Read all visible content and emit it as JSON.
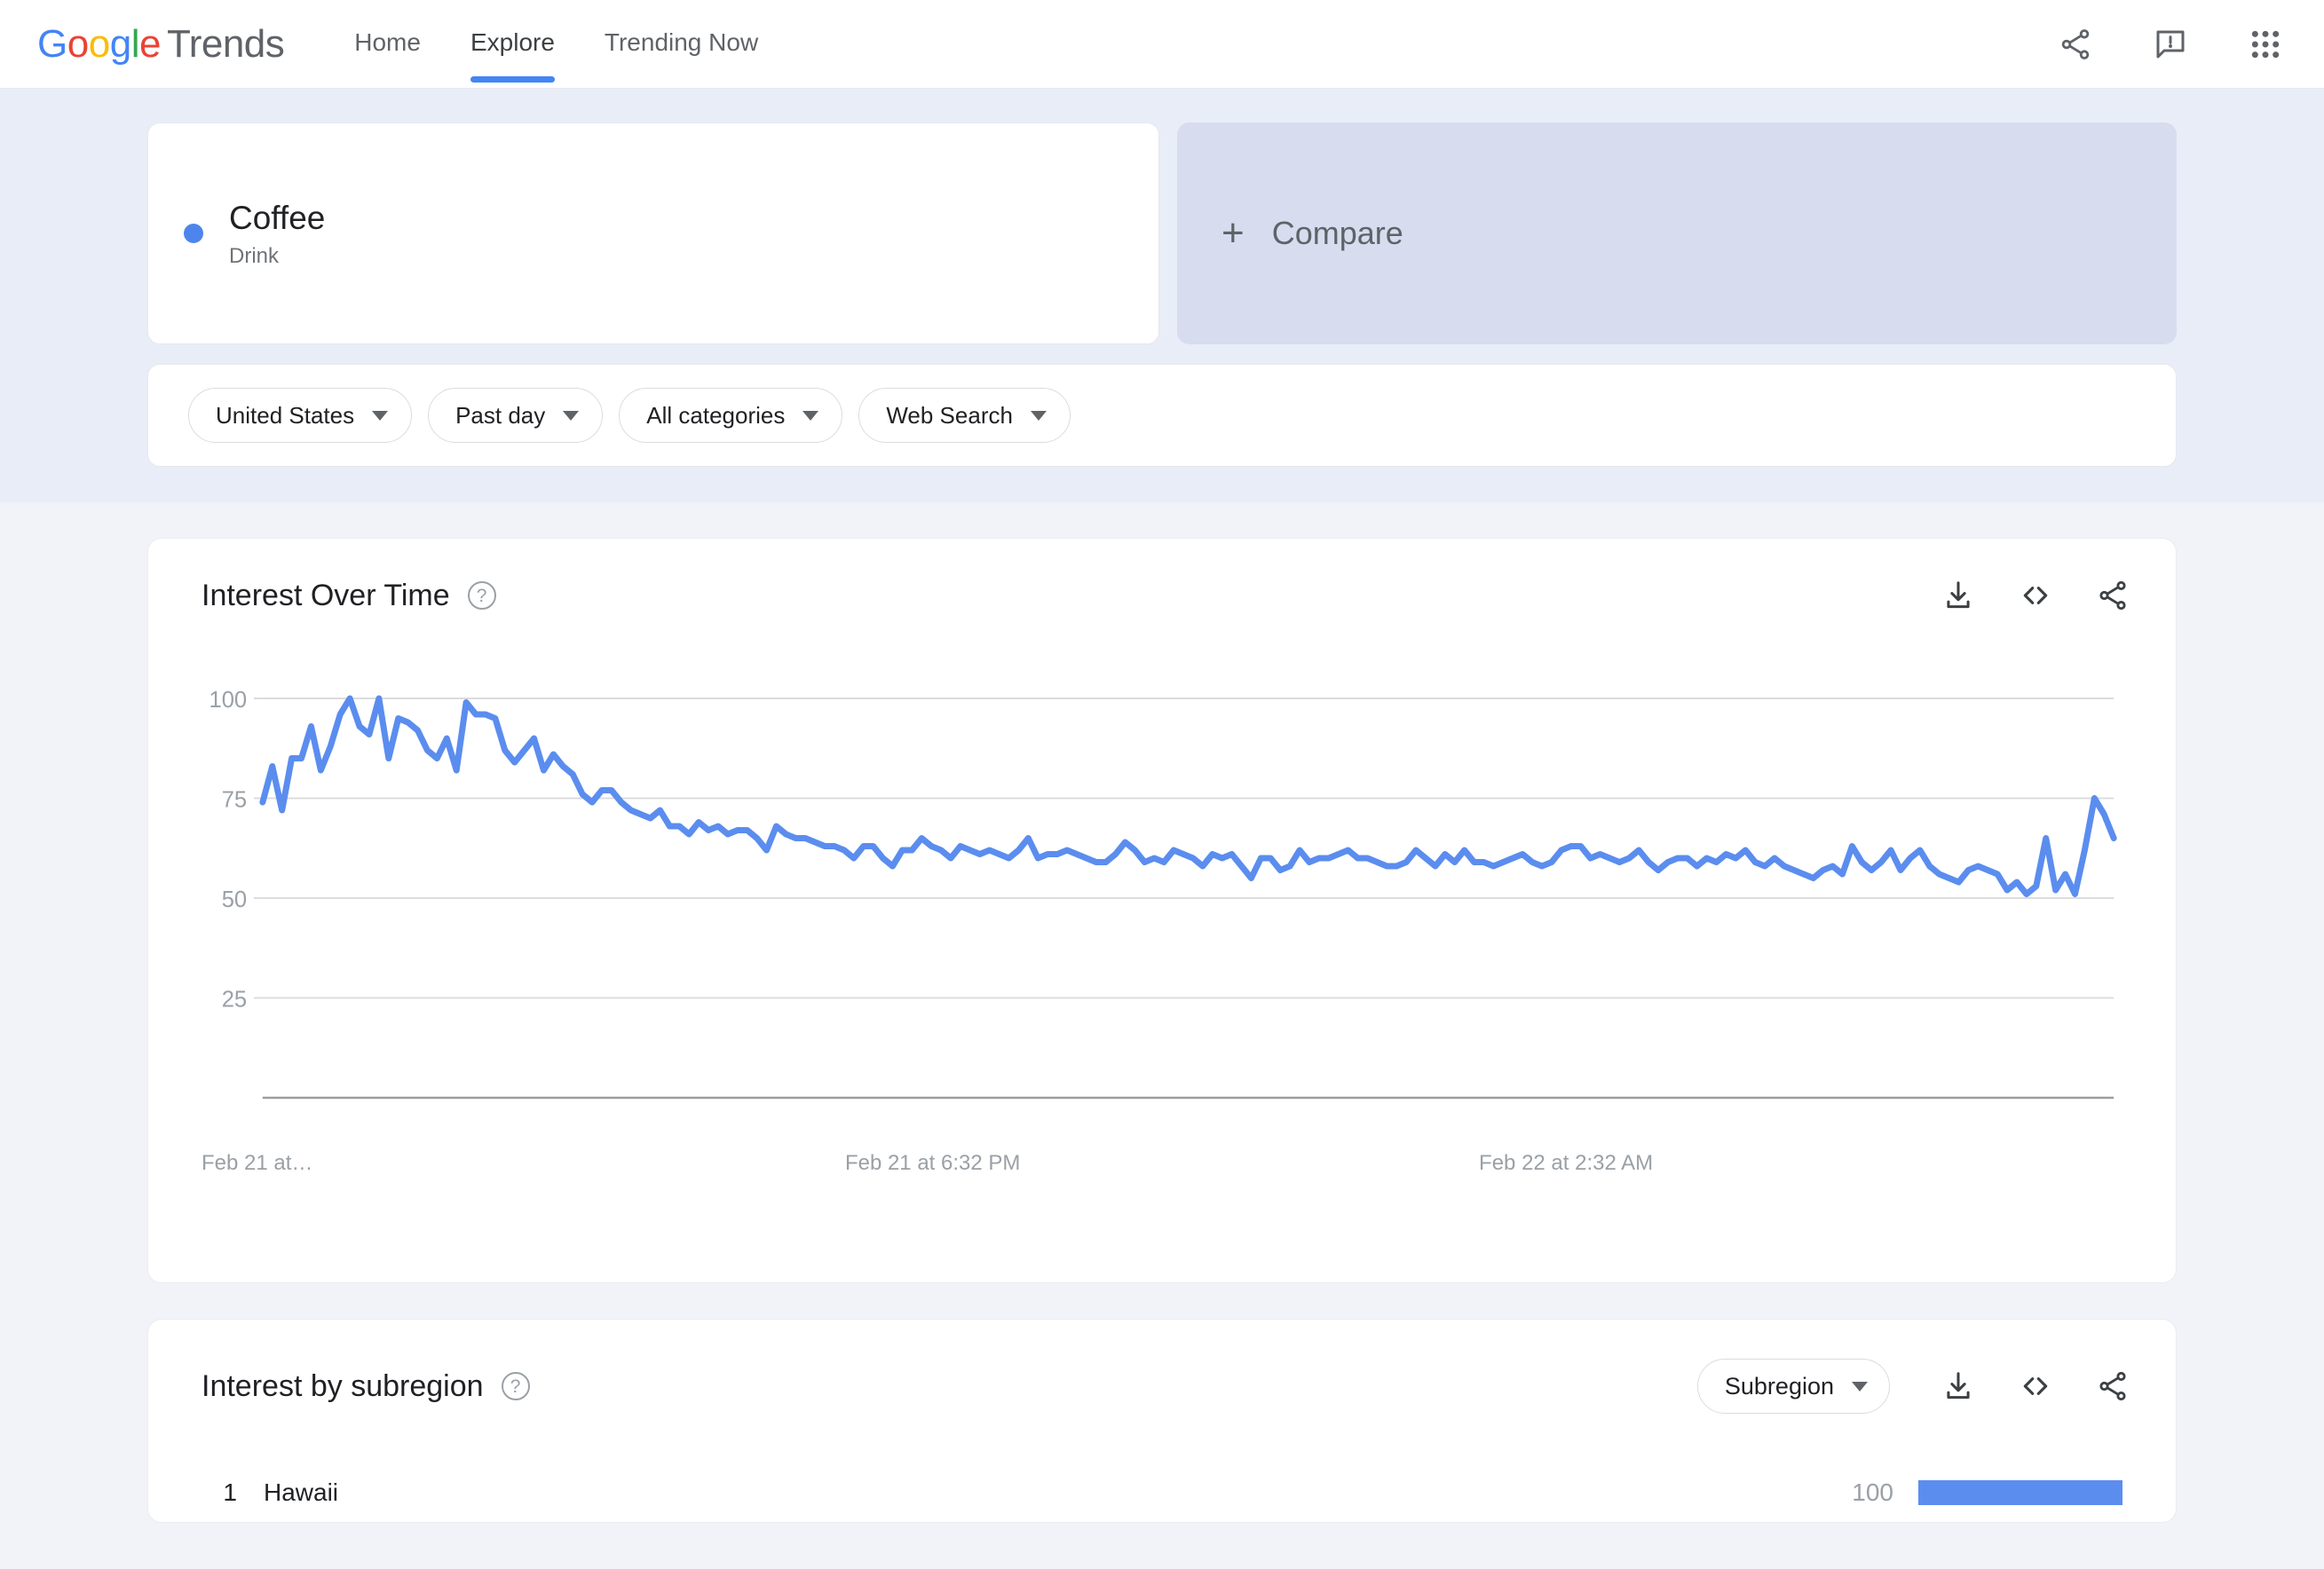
{
  "header": {
    "logo": {
      "google": "Google",
      "trends": "Trends"
    },
    "nav": [
      {
        "label": "Home",
        "active": false
      },
      {
        "label": "Explore",
        "active": true
      },
      {
        "label": "Trending Now",
        "active": false
      }
    ],
    "actions": [
      {
        "name": "share-icon",
        "label": "Share"
      },
      {
        "name": "feedback-icon",
        "label": "Send feedback"
      },
      {
        "name": "apps-grid-icon",
        "label": "Google apps"
      }
    ]
  },
  "query": {
    "term": {
      "title": "Coffee",
      "subtitle": "Drink",
      "color": "#4e85ec"
    },
    "compare": {
      "label": "Compare",
      "plus": "+"
    },
    "filters": [
      {
        "name": "location-filter",
        "label": "United States"
      },
      {
        "name": "time-filter",
        "label": "Past day"
      },
      {
        "name": "category-filter",
        "label": "All categories"
      },
      {
        "name": "search-type-filter",
        "label": "Web Search"
      }
    ]
  },
  "interest_over_time": {
    "title": "Interest Over Time",
    "help": "?",
    "actions": [
      {
        "name": "download-icon",
        "label": "Download CSV"
      },
      {
        "name": "embed-code-icon",
        "label": "Embed"
      },
      {
        "name": "share-icon",
        "label": "Share"
      }
    ]
  },
  "interest_by_subregion": {
    "title": "Interest by subregion",
    "help": "?",
    "dropdown_label": "Subregion",
    "actions": [
      {
        "name": "download-icon",
        "label": "Download CSV"
      },
      {
        "name": "embed-code-icon",
        "label": "Embed"
      },
      {
        "name": "share-icon",
        "label": "Share"
      }
    ],
    "rows": [
      {
        "rank": "1",
        "name": "Hawaii",
        "value": "100",
        "bar_pct": 100
      }
    ]
  },
  "chart_data": {
    "type": "line",
    "title": "Interest Over Time",
    "xlabel": "",
    "ylabel": "",
    "ylim": [
      0,
      108
    ],
    "yticks": [
      25,
      50,
      75,
      100
    ],
    "ytick_labels": [
      "25",
      "50",
      "75",
      "100"
    ],
    "grid": true,
    "legend": false,
    "line_color": "#5b8def",
    "x_tick_labels": [
      "Feb 21 at…",
      "Feb 21 at 6:32 PM",
      "Feb 22 at 2:32 AM"
    ],
    "x_tick_positions": [
      0.0,
      0.335,
      0.665
    ],
    "series": [
      {
        "name": "Coffee",
        "values": [
          74,
          83,
          72,
          85,
          85,
          93,
          82,
          88,
          96,
          100,
          93,
          91,
          100,
          85,
          95,
          94,
          92,
          87,
          85,
          90,
          82,
          99,
          96,
          96,
          95,
          87,
          84,
          87,
          90,
          82,
          86,
          83,
          81,
          76,
          74,
          77,
          77,
          74,
          72,
          71,
          70,
          72,
          68,
          68,
          66,
          69,
          67,
          68,
          66,
          67,
          67,
          65,
          62,
          68,
          66,
          65,
          65,
          64,
          63,
          63,
          62,
          60,
          63,
          63,
          60,
          58,
          62,
          62,
          65,
          63,
          62,
          60,
          63,
          62,
          61,
          62,
          61,
          60,
          62,
          65,
          60,
          61,
          61,
          62,
          61,
          60,
          59,
          59,
          61,
          64,
          62,
          59,
          60,
          59,
          62,
          61,
          60,
          58,
          61,
          60,
          61,
          58,
          55,
          60,
          60,
          57,
          58,
          62,
          59,
          60,
          60,
          61,
          62,
          60,
          60,
          59,
          58,
          58,
          59,
          62,
          60,
          58,
          61,
          59,
          62,
          59,
          59,
          58,
          59,
          60,
          61,
          59,
          58,
          59,
          62,
          63,
          63,
          60,
          61,
          60,
          59,
          60,
          62,
          59,
          57,
          59,
          60,
          60,
          58,
          60,
          59,
          61,
          60,
          62,
          59,
          58,
          60,
          58,
          57,
          56,
          55,
          57,
          58,
          56,
          63,
          59,
          57,
          59,
          62,
          57,
          60,
          62,
          58,
          56,
          55,
          54,
          57,
          58,
          57,
          56,
          52,
          54,
          51,
          53,
          65,
          52,
          56,
          51,
          62,
          75,
          71,
          65
        ]
      }
    ]
  }
}
